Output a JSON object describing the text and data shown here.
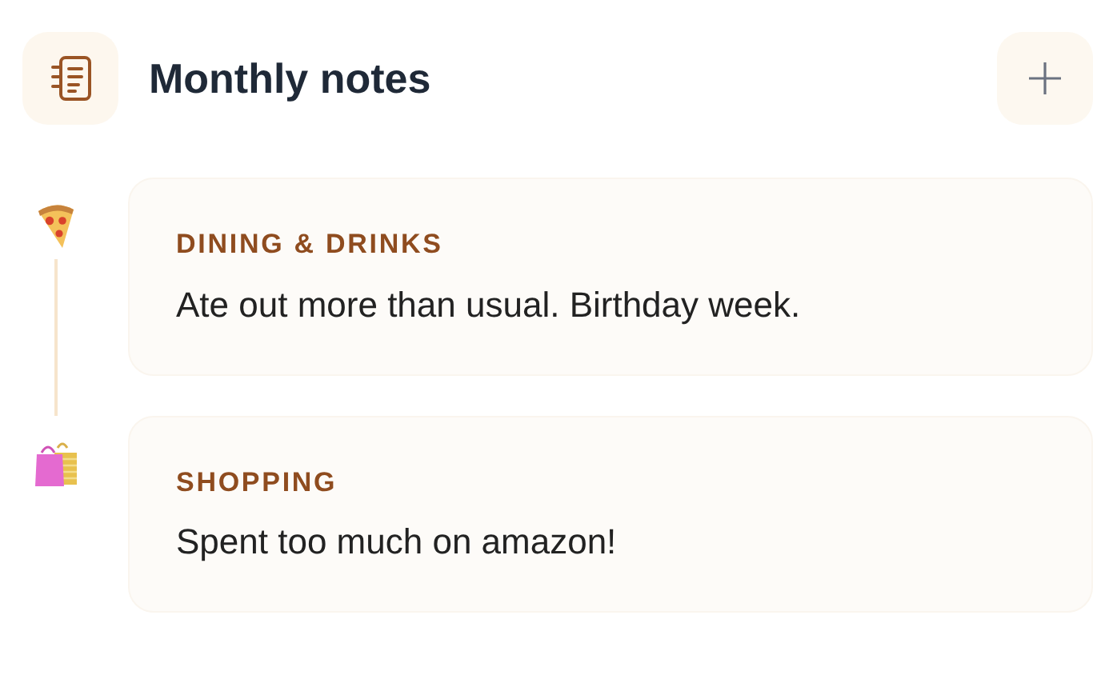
{
  "header": {
    "title": "Monthly notes"
  },
  "notes": [
    {
      "kind": "dining",
      "category": "DINING & DRINKS",
      "text": "Ate out more than usual. Birthday week."
    },
    {
      "kind": "shopping",
      "category": "SHOPPING",
      "text": "Spent too much on amazon!"
    }
  ]
}
